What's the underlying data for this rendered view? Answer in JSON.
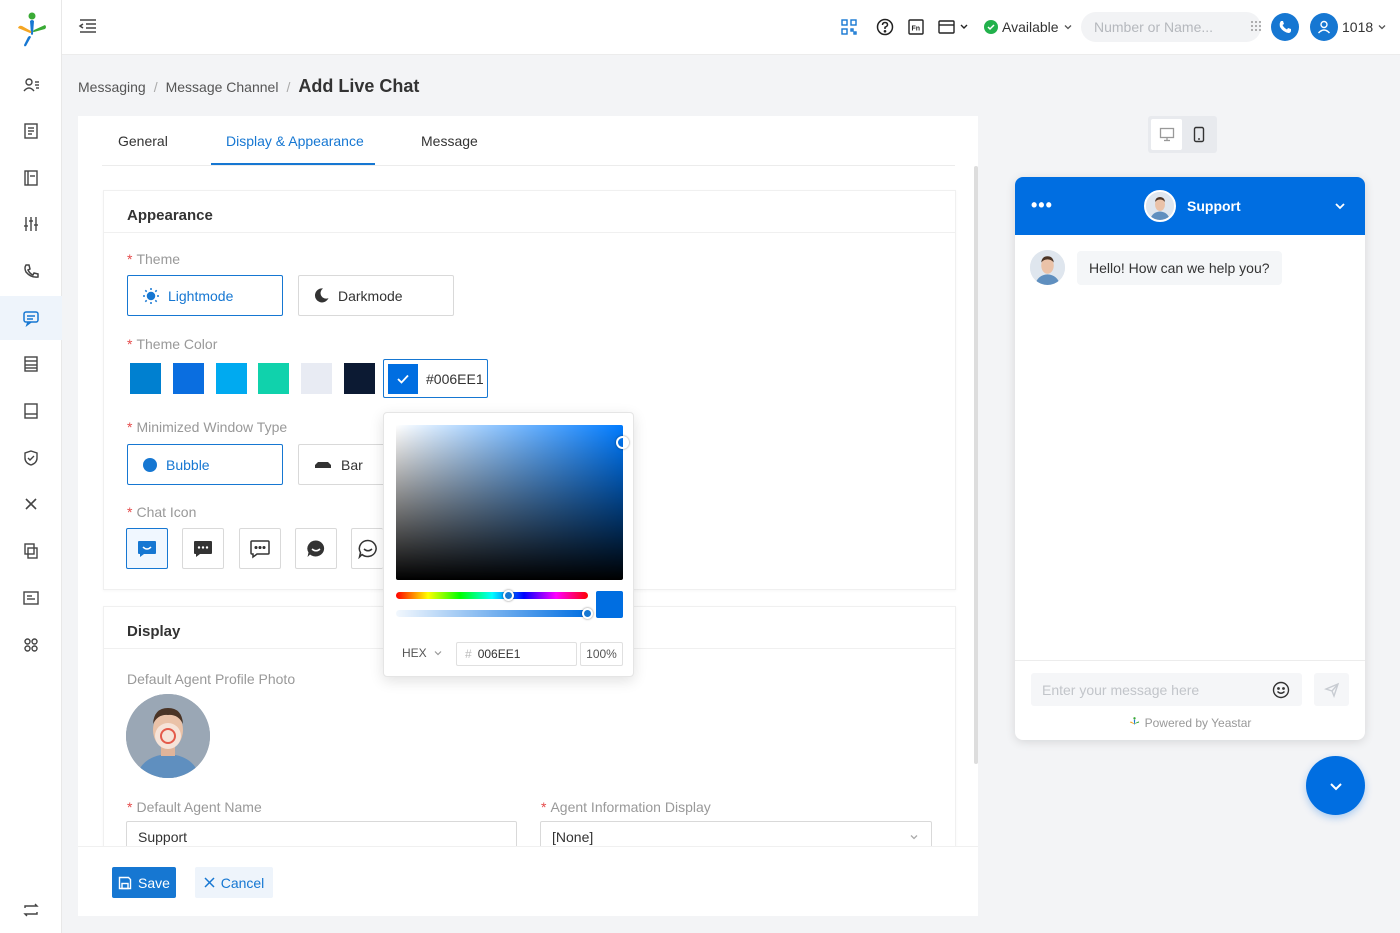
{
  "topbar": {
    "status_label": "Available",
    "search_placeholder": "Number or Name...",
    "user_extension": "1018"
  },
  "breadcrumb": {
    "items": [
      "Messaging",
      "Message Channel"
    ],
    "separator": "/",
    "current": "Add Live Chat"
  },
  "tabs": [
    {
      "label": "General",
      "active": false
    },
    {
      "label": "Display & Appearance",
      "active": true
    },
    {
      "label": "Message",
      "active": false
    }
  ],
  "appearance": {
    "title": "Appearance",
    "theme": {
      "label": "Theme",
      "options": [
        {
          "label": "Lightmode",
          "icon": "sun-icon",
          "selected": true
        },
        {
          "label": "Darkmode",
          "icon": "moon-icon",
          "selected": false
        }
      ]
    },
    "theme_color": {
      "label": "Theme Color",
      "swatches": [
        "#0080d0",
        "#0a6ee0",
        "#00aaf0",
        "#10d2ac",
        "#e8ebf3",
        "#0c1a33"
      ],
      "custom_value": "#006EE1"
    },
    "minimized_window": {
      "label": "Minimized Window Type",
      "options": [
        {
          "label": "Bubble",
          "icon": "bubble-icon",
          "selected": true
        },
        {
          "label": "Bar",
          "icon": "bar-icon",
          "selected": false
        }
      ]
    },
    "chat_icon": {
      "label": "Chat Icon",
      "icons": [
        "chat-smile-square-icon",
        "chat-dots-icon",
        "chat-dots-outline-icon",
        "chat-smile-round-icon",
        "chat-round-outline-icon"
      ]
    }
  },
  "color_picker": {
    "format": "HEX",
    "hash": "#",
    "hex": "006EE1",
    "alpha": "100%",
    "alpha_fraction": 1.0
  },
  "display": {
    "title": "Display",
    "profile_photo_label": "Default Agent Profile Photo",
    "agent_name_label": "Default Agent Name",
    "agent_name_value": "Support",
    "agent_info_label": "Agent Information Display",
    "agent_info_value": "[None]"
  },
  "footer": {
    "save_label": "Save",
    "cancel_label": "Cancel"
  },
  "preview": {
    "header_title": "Support",
    "menu_dots": "•••",
    "greeting": "Hello! How can we help you?",
    "input_placeholder": "Enter your message here",
    "powered_by": "Powered by Yeastar",
    "accent_color": "#006ee1"
  }
}
